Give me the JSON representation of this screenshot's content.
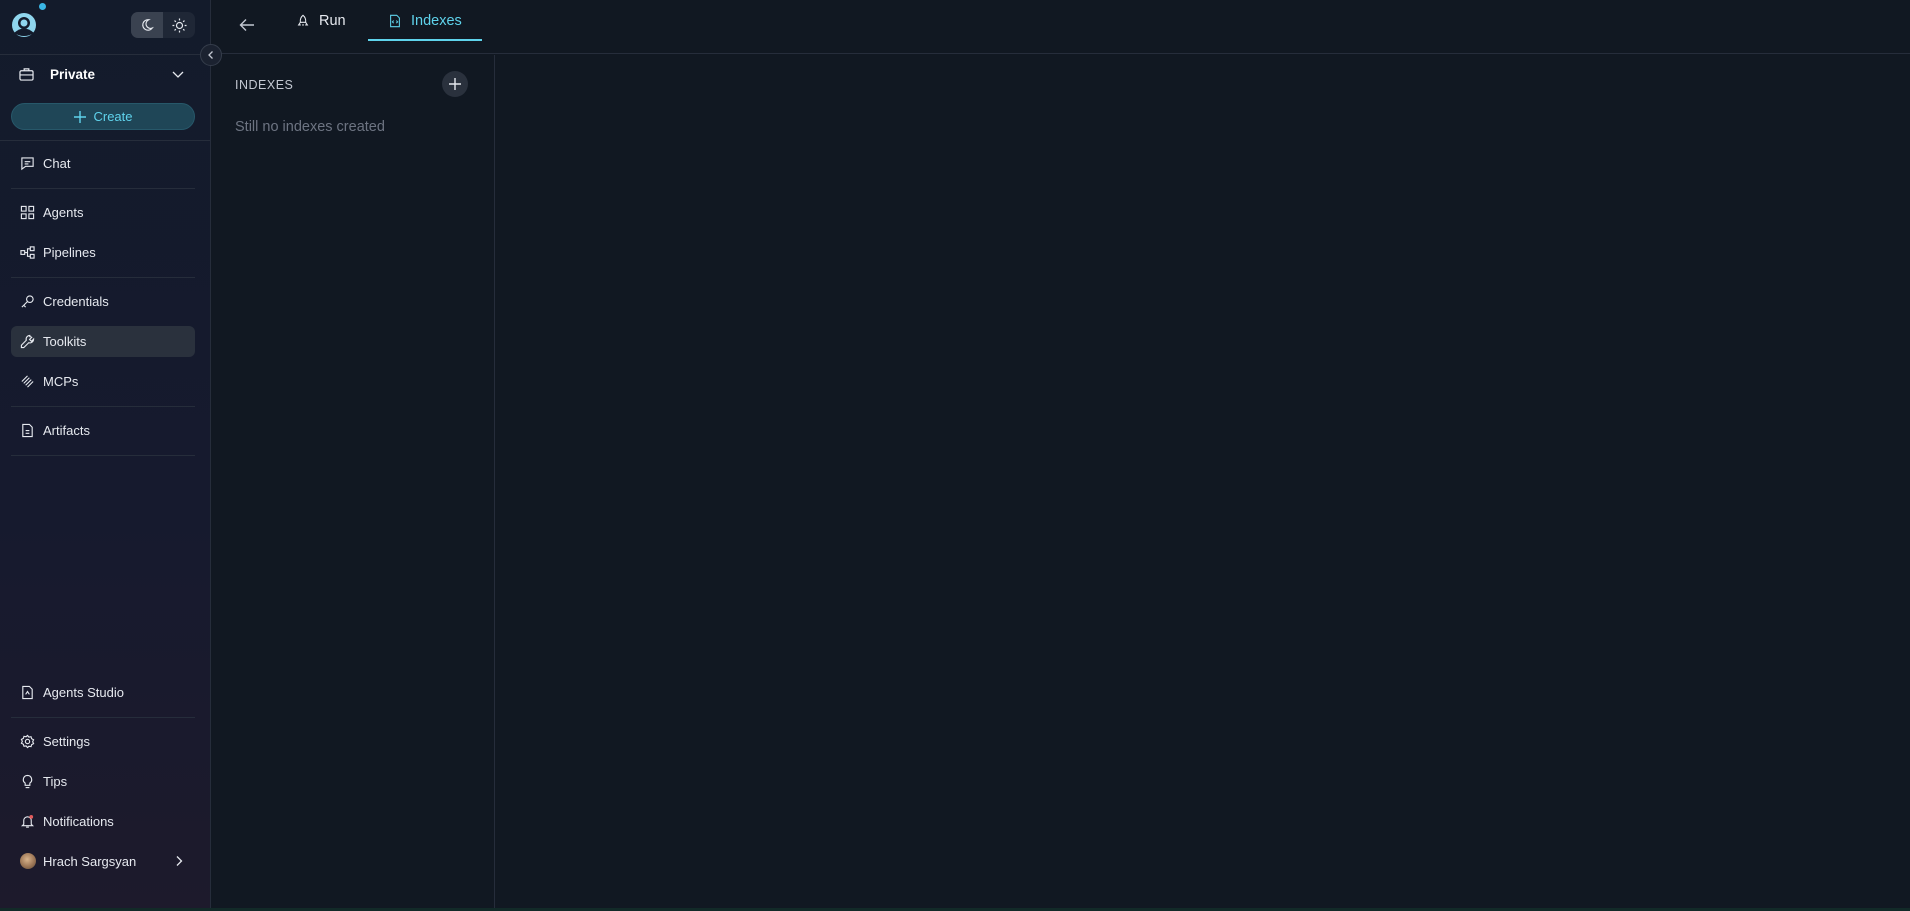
{
  "sidebar": {
    "workspace": "Private",
    "create_label": "Create",
    "items": [
      {
        "label": "Chat",
        "icon": "chat-icon"
      },
      {
        "label": "Agents",
        "icon": "grid-icon"
      },
      {
        "label": "Pipelines",
        "icon": "pipeline-icon"
      },
      {
        "label": "Credentials",
        "icon": "key-icon"
      },
      {
        "label": "Toolkits",
        "icon": "wrench-icon",
        "active": true
      },
      {
        "label": "MCPs",
        "icon": "mcp-icon"
      },
      {
        "label": "Artifacts",
        "icon": "artifact-icon"
      }
    ],
    "bottom_items": [
      {
        "label": "Agents Studio",
        "icon": "studio-icon"
      },
      {
        "label": "Settings",
        "icon": "gear-icon"
      },
      {
        "label": "Tips",
        "icon": "lightbulb-icon"
      },
      {
        "label": "Notifications",
        "icon": "bell-icon"
      }
    ],
    "user": {
      "name": "Hrach Sargsyan"
    }
  },
  "topbar": {
    "tabs": [
      {
        "label": "Run",
        "icon": "rocket-icon"
      },
      {
        "label": "Indexes",
        "icon": "document-icon",
        "active": true
      }
    ]
  },
  "index_panel": {
    "title": "INDEXES",
    "empty_message": "Still no indexes created"
  },
  "colors": {
    "accent": "#5fd3ec",
    "background": "#111822",
    "sidebar": "#141a2b",
    "active_item": "#2a313d"
  }
}
